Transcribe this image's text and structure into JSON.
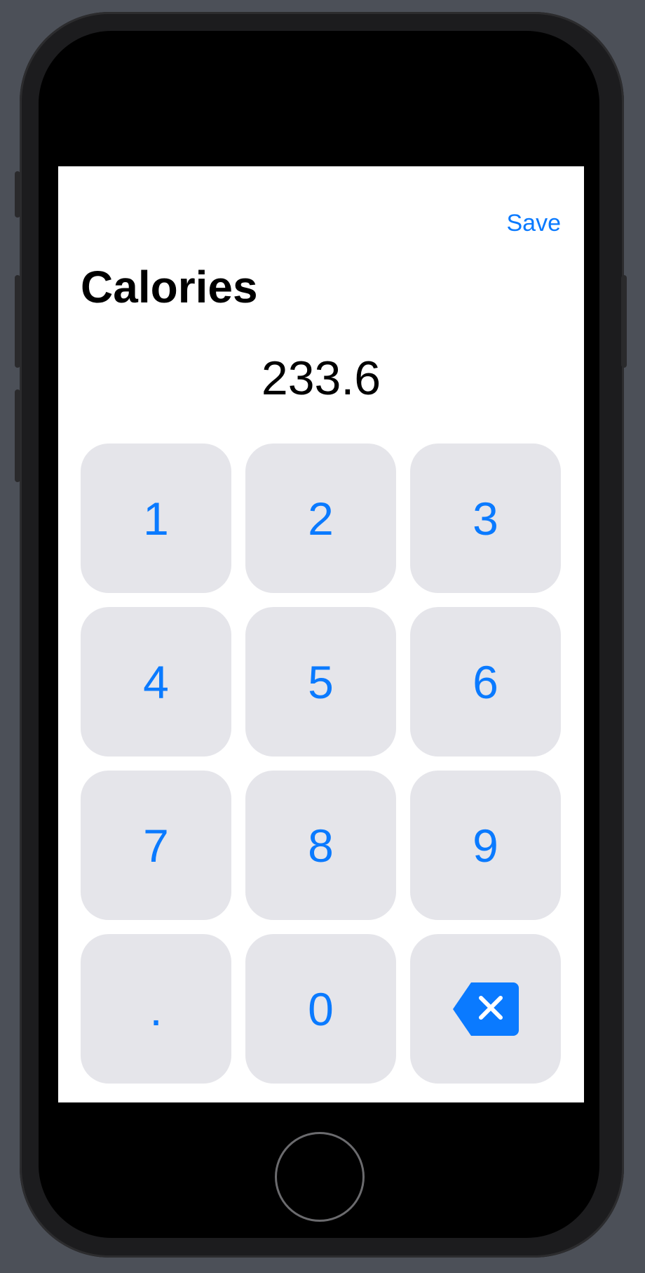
{
  "header": {
    "save_label": "Save",
    "title": "Calories"
  },
  "display": {
    "value": "233.6"
  },
  "keypad": {
    "keys": [
      "1",
      "2",
      "3",
      "4",
      "5",
      "6",
      "7",
      "8",
      "9",
      ".",
      "0"
    ],
    "backspace_icon": "backspace-icon"
  },
  "colors": {
    "accent": "#0a7aff",
    "key_background": "#e5e5ea",
    "screen_background": "#ffffff",
    "device_background": "#4c5058"
  }
}
